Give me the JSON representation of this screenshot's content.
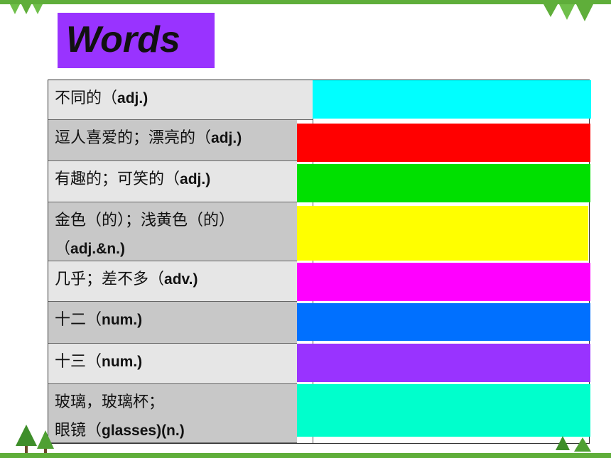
{
  "title": "Words",
  "rows": [
    {
      "cn": "不同的（",
      "pos": "adj.)",
      "cn2": "",
      "pos2": "",
      "color": "#00ffff"
    },
    {
      "cn": "逗人喜爱的；漂亮的（",
      "pos": "adj.)",
      "cn2": "",
      "pos2": "",
      "color": "#ff0000"
    },
    {
      "cn": "有趣的；可笑的（",
      "pos": "adj.)",
      "cn2": "",
      "pos2": "",
      "color": "#00e000"
    },
    {
      "cn": "金色（的）；浅黄色（的）",
      "pos": "",
      "cn2": "（",
      "pos2": "adj.&n.)",
      "color": "#ffff00"
    },
    {
      "cn": "几乎；差不多（",
      "pos": "adv.)",
      "cn2": "",
      "pos2": "",
      "color": "#ff00ff"
    },
    {
      "cn": "十二（",
      "pos": "num.)",
      "cn2": "",
      "pos2": "",
      "color": "#0070ff"
    },
    {
      "cn": "十三（",
      "pos": "num.)",
      "cn2": "",
      "pos2": "",
      "color": "#9933ff"
    },
    {
      "cn": "玻璃，玻璃杯；",
      "pos": "",
      "cn2": "眼镜（",
      "pos2": "glasses)(n.)",
      "color": "#00ffcc"
    }
  ],
  "theme": {
    "band": "#5fae3a",
    "leftCellOdd": "#e6e6e6",
    "leftCellEven": "#c8c8c8"
  }
}
